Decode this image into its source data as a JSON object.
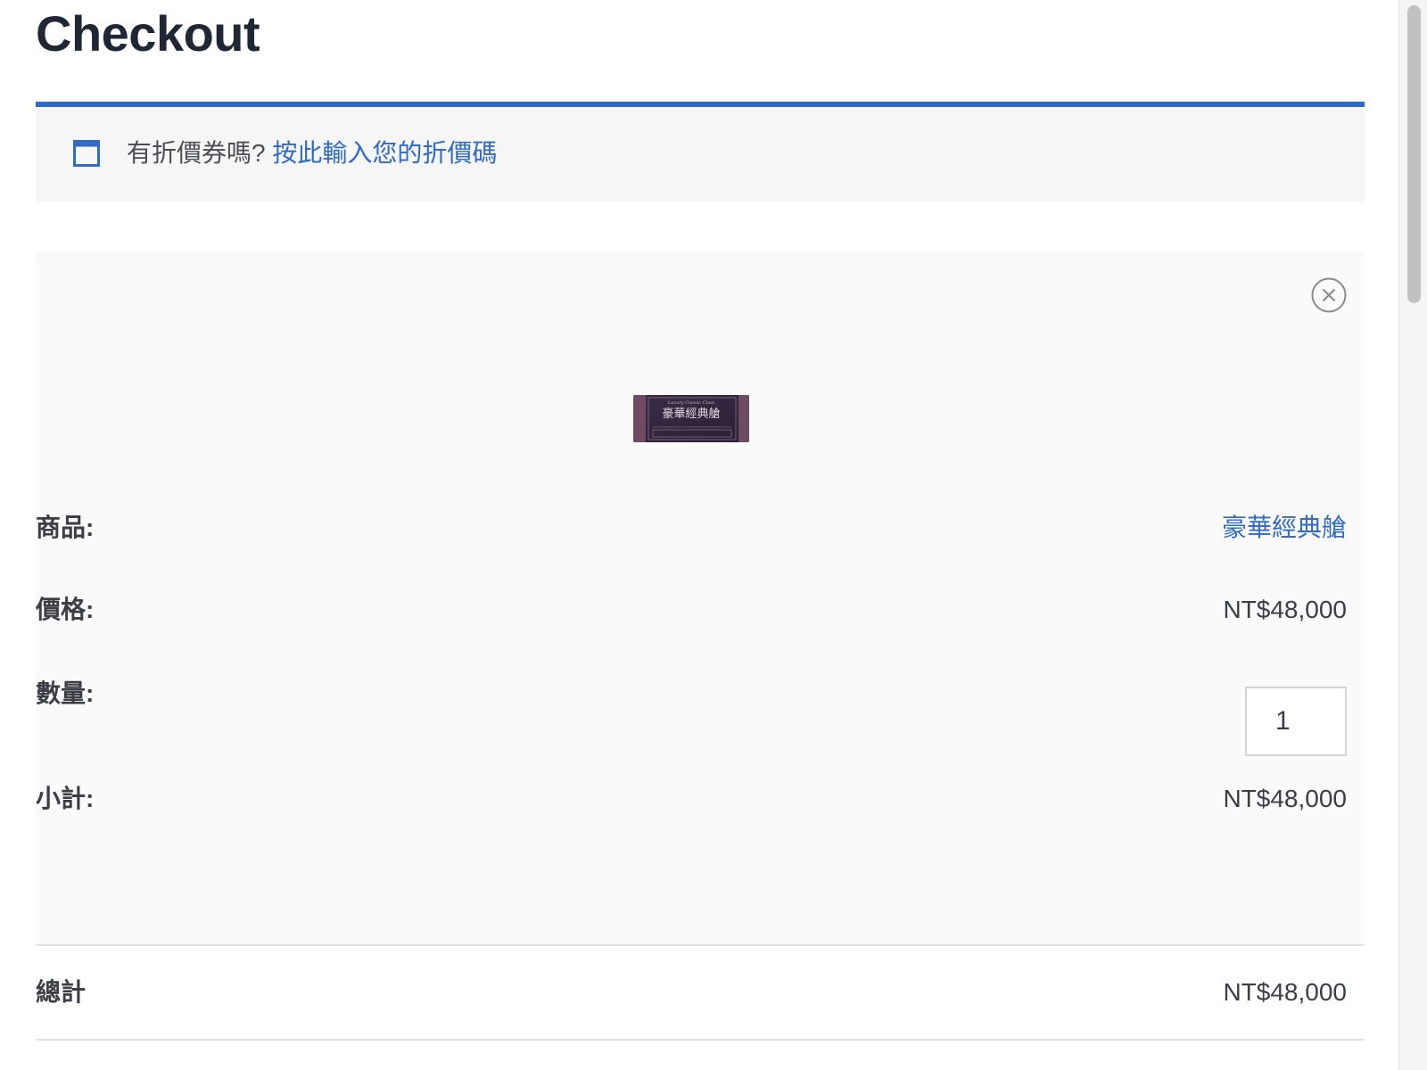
{
  "page": {
    "title": "Checkout"
  },
  "coupon": {
    "prompt": "有折價券嗎?",
    "link_label": "按此輸入您的折價碼"
  },
  "cart_item": {
    "product_label": "商品:",
    "product_name": "豪華經典艙",
    "price_label": "價格:",
    "price": "NT$48,000",
    "quantity_label": "數量:",
    "quantity": "1",
    "subtotal_label": "小計:",
    "subtotal": "NT$48,000",
    "thumbnail": {
      "main_text": "豪華經典艙",
      "script_text": "Luxury Classic Class"
    }
  },
  "totals": {
    "label": "總計",
    "value": "NT$48,000"
  },
  "icons": {
    "coupon": "window-icon",
    "remove": "close-circle-icon"
  },
  "colors": {
    "accent": "#2f6ac4",
    "title": "#1e2733",
    "text": "#3b3f45",
    "coupon_bg": "#f6f6f6",
    "card_bg": "#fafafa"
  }
}
